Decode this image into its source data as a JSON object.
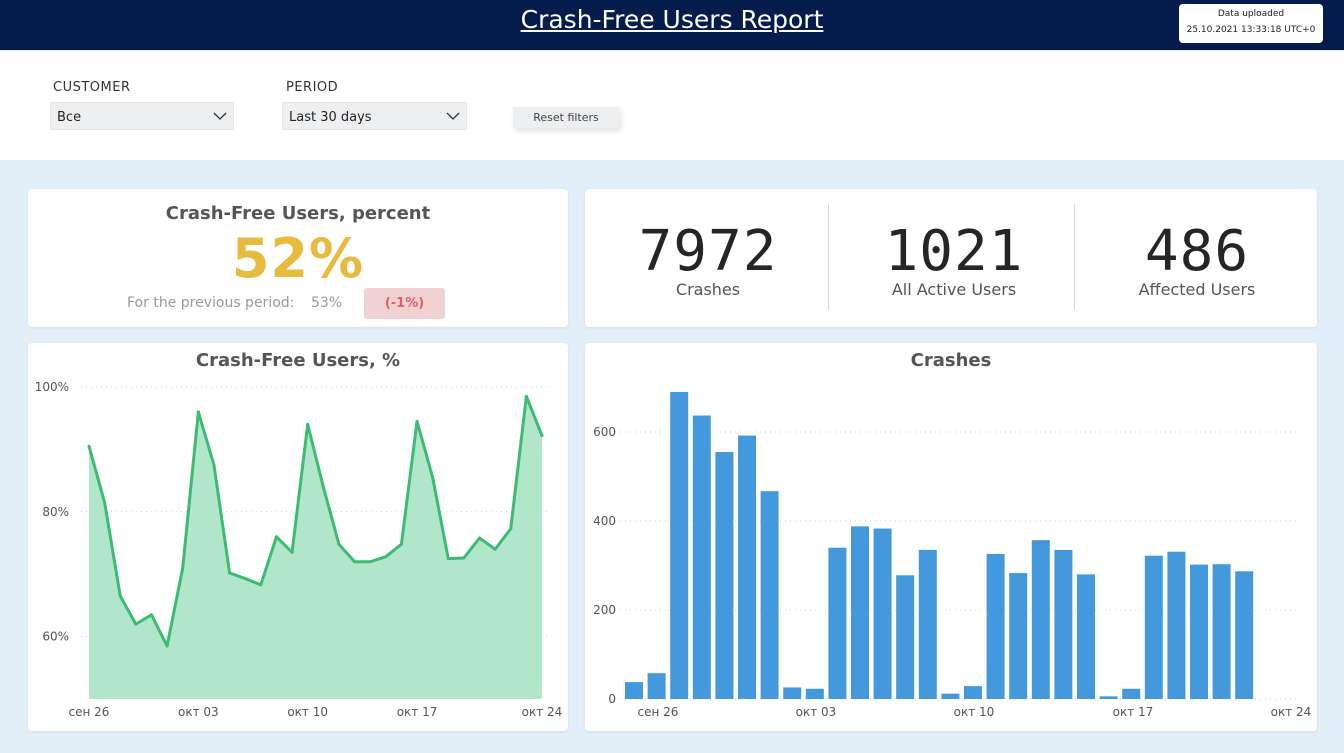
{
  "header": {
    "title": "Crash-Free Users Report",
    "upload_label": "Data uploaded",
    "upload_time": "25.10.2021 13:33:18 UTC+0"
  },
  "filters": {
    "customer_label": "CUSTOMER",
    "customer_value": "Все",
    "period_label": "PERIOD",
    "period_value": "Last 30 days",
    "reset_label": "Reset filters"
  },
  "summary": {
    "title": "Crash-Free Users, percent",
    "value": "52%",
    "prev_label": "For the previous period:",
    "prev_value": "53%",
    "delta": "(-1%)",
    "delta_color": "#e05f68",
    "value_color": "#e7bb3e"
  },
  "kpis": [
    {
      "value": "7972",
      "label": "Crashes"
    },
    {
      "value": "1021",
      "label": "All Active Users"
    },
    {
      "value": "486",
      "label": "Affected Users"
    }
  ],
  "chart_data": [
    {
      "type": "area",
      "title": "Crash-Free Users, %",
      "color": "#3dbb72",
      "fill": "#b2e6cb",
      "ylim": [
        50,
        100
      ],
      "yticks": [
        60,
        80,
        100
      ],
      "ytick_labels": [
        "60%",
        "80%",
        "100%"
      ],
      "xticks": [
        "сен 26",
        "окт 03",
        "окт 10",
        "окт 17",
        "окт 24"
      ],
      "grid": true,
      "values": [
        90.5,
        81.5,
        66.5,
        62,
        63.5,
        58.5,
        71,
        96,
        87.5,
        70.2,
        69.3,
        68.3,
        76,
        73.5,
        94,
        84,
        74.8,
        72,
        72,
        72.8,
        74.8,
        94.5,
        85.5,
        72.5,
        72.6,
        75.8,
        74,
        77.3,
        98.5,
        92.2
      ]
    },
    {
      "type": "bar",
      "title": "Crashes",
      "color": "#4399dc",
      "ylim": [
        0,
        700
      ],
      "yticks": [
        0,
        200,
        400,
        600
      ],
      "xticks": [
        "сен 26",
        "окт 03",
        "окт 10",
        "окт 17",
        "окт 24"
      ],
      "grid": true,
      "values": [
        38,
        58,
        690,
        637,
        555,
        592,
        467,
        26,
        23,
        340,
        388,
        383,
        278,
        335,
        12,
        29,
        326,
        283,
        357,
        335,
        280,
        6,
        23,
        322,
        331,
        302,
        303,
        287
      ]
    }
  ]
}
